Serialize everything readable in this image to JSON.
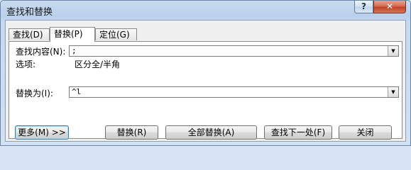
{
  "window": {
    "title": "查找和替换",
    "help_label": "?",
    "close_label": "✕"
  },
  "tabs": [
    {
      "label": "查找(D)",
      "active": false
    },
    {
      "label": "替换(P)",
      "active": true
    },
    {
      "label": "定位(G)",
      "active": false
    }
  ],
  "find": {
    "label": "查找内容(N):",
    "value": ";",
    "options_label": "选项:",
    "options_value": "区分全/半角"
  },
  "replace": {
    "label": "替换为(I):",
    "value": "^l"
  },
  "buttons": {
    "more": "更多(M) >>",
    "replace": "替换(R)",
    "replace_all": "全部替换(A)",
    "find_next": "查找下一处(F)",
    "close": "关闭"
  },
  "icons": {
    "dropdown": "chevron-down-icon"
  }
}
